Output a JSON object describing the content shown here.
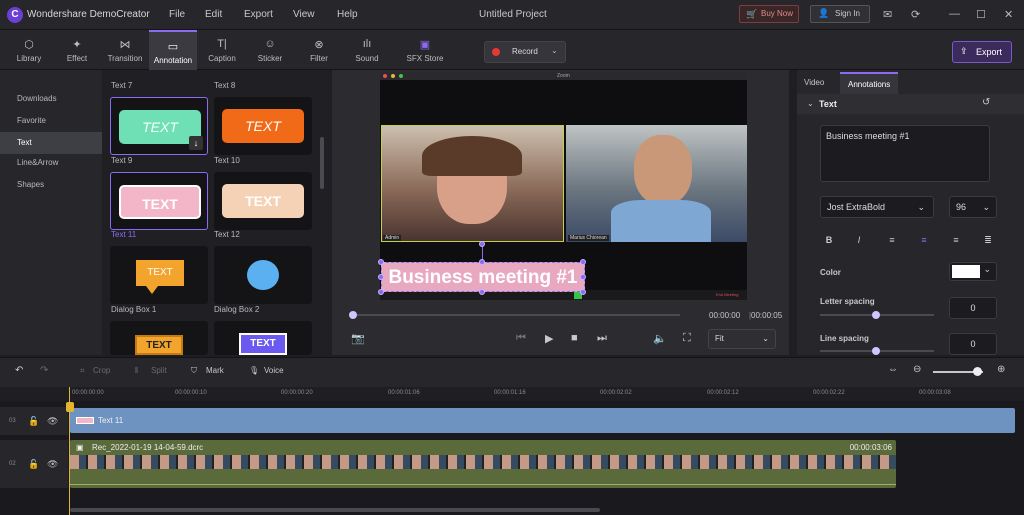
{
  "app": {
    "title": "Wondershare DemoCreator",
    "window_title": "Untitled Project",
    "buy_now": "Buy Now",
    "sign_in": "Sign In"
  },
  "menu": [
    "File",
    "Edit",
    "Export",
    "View",
    "Help"
  ],
  "toolbar": {
    "tools": [
      {
        "label": "Library",
        "icon": "cube-icon"
      },
      {
        "label": "Effect",
        "icon": "magic-wand-icon"
      },
      {
        "label": "Transition",
        "icon": "transition-icon"
      },
      {
        "label": "Annotation",
        "icon": "annotation-icon"
      },
      {
        "label": "Caption",
        "icon": "caption-icon"
      },
      {
        "label": "Sticker",
        "icon": "sticker-icon"
      },
      {
        "label": "Filter",
        "icon": "filter-icon"
      },
      {
        "label": "Sound",
        "icon": "sound-icon"
      },
      {
        "label": "SFX Store",
        "icon": "store-icon"
      }
    ],
    "active": "Annotation",
    "record_label": "Record",
    "export_label": "Export"
  },
  "leftnav": [
    "Downloads",
    "Favorite",
    "Text",
    "Line&Arrow",
    "Shapes"
  ],
  "leftnav_active": "Text",
  "library": {
    "row0": [
      "Text 7",
      "Text 8"
    ],
    "items": [
      {
        "label": "Text 9",
        "pill_text": "TEXT",
        "color": "#6fe0b5"
      },
      {
        "label": "Text 10",
        "pill_text": "TEXT",
        "color": "#f06a18"
      },
      {
        "label": "Text 11",
        "pill_text": "TEXT",
        "color": "#f2b6c8"
      },
      {
        "label": "Text 12",
        "pill_text": "TEXT",
        "color": "#f5d2b5"
      },
      {
        "label": "Dialog Box 1",
        "pill_text": "TEXT",
        "color": "#f2a42c"
      },
      {
        "label": "Dialog Box 2",
        "pill_text": "TEXT",
        "color": "#5ab0f0"
      },
      {
        "label": "",
        "pill_text": "TEXT",
        "color": "#f2a42c"
      },
      {
        "label": "",
        "pill_text": "TEXT",
        "color": "#6a5af0"
      }
    ]
  },
  "preview": {
    "screen_title": "Zoom",
    "left_name": "Admin",
    "right_name": "Marius Chiorean",
    "end_meeting": "End Meeting",
    "overlay_text": "Business meeting #1",
    "time_current": "00:00:00",
    "time_total": "00:00:05",
    "zoom_option": "Fit"
  },
  "properties": {
    "tabs": [
      "Video",
      "Annotations"
    ],
    "active_tab": "Annotations",
    "section": "Text",
    "text_value": "Business meeting #1",
    "font": "Jost ExtraBold",
    "font_size": "96",
    "color_label": "Color",
    "text_color": "#ffffff",
    "letter_spacing_label": "Letter spacing",
    "letter_spacing": "0",
    "line_spacing_label": "Line spacing",
    "line_spacing": "0"
  },
  "timeline": {
    "tools": [
      "Crop",
      "Split",
      "Mark",
      "Voice"
    ],
    "ruler": [
      "00:00:00:00",
      "00:00:00:10",
      "00:00:00:20",
      "00:00:01:06",
      "00:00:01:16",
      "00:00:02:02",
      "00:00:02:12",
      "00:00:02:22",
      "00:00:03:08"
    ],
    "tracks": [
      {
        "num": "03",
        "clip": "Text 11"
      },
      {
        "num": "02",
        "clip": "Rec_2022-01-19 14-04-59.dcrc",
        "duration": "00:00:03:06"
      }
    ]
  }
}
